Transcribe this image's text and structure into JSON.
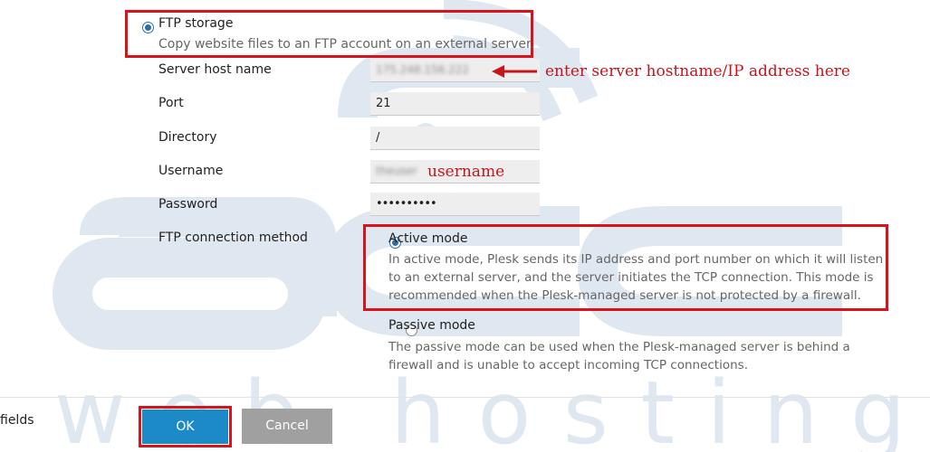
{
  "ftp_storage": {
    "title": "FTP storage",
    "description": "Copy website files to an FTP account on an external server."
  },
  "form": {
    "server_host": {
      "label": "Server host name",
      "value": "175.248.156.222"
    },
    "port": {
      "label": "Port",
      "value": "21"
    },
    "directory": {
      "label": "Directory",
      "value": "/"
    },
    "username": {
      "label": "Username",
      "value": "theuser"
    },
    "password": {
      "label": "Password",
      "value": "••••••••••"
    },
    "connection_method": {
      "label": "FTP connection method"
    }
  },
  "modes": {
    "active": {
      "title": "Active mode",
      "desc_lines": [
        "In active mode, Plesk sends its IP address and port number on which it will listen",
        "to an external server, and the server initiates the TCP connection. This mode is",
        "recommended when the Plesk-managed server is not protected by a firewall."
      ],
      "selected": true
    },
    "passive": {
      "title": "Passive mode",
      "desc_lines": [
        "The passive mode can be used when the Plesk-managed server is behind a",
        "firewall and is unable to accept incoming TCP connections."
      ],
      "selected": false
    }
  },
  "annotations": {
    "host": "enter server hostname/IP address here",
    "username": "username"
  },
  "footer": {
    "required_text": "fields",
    "ok_label": "OK",
    "cancel_label": "Cancel"
  },
  "watermark": {
    "line1": "accu",
    "line2": "web hosting"
  },
  "colors": {
    "accent": "#2d6ea8",
    "ok_button": "#1d8ac8",
    "cancel_button": "#a0a0a0",
    "annotation_red": "#d8131b",
    "watermark": "#dfe7f1"
  }
}
